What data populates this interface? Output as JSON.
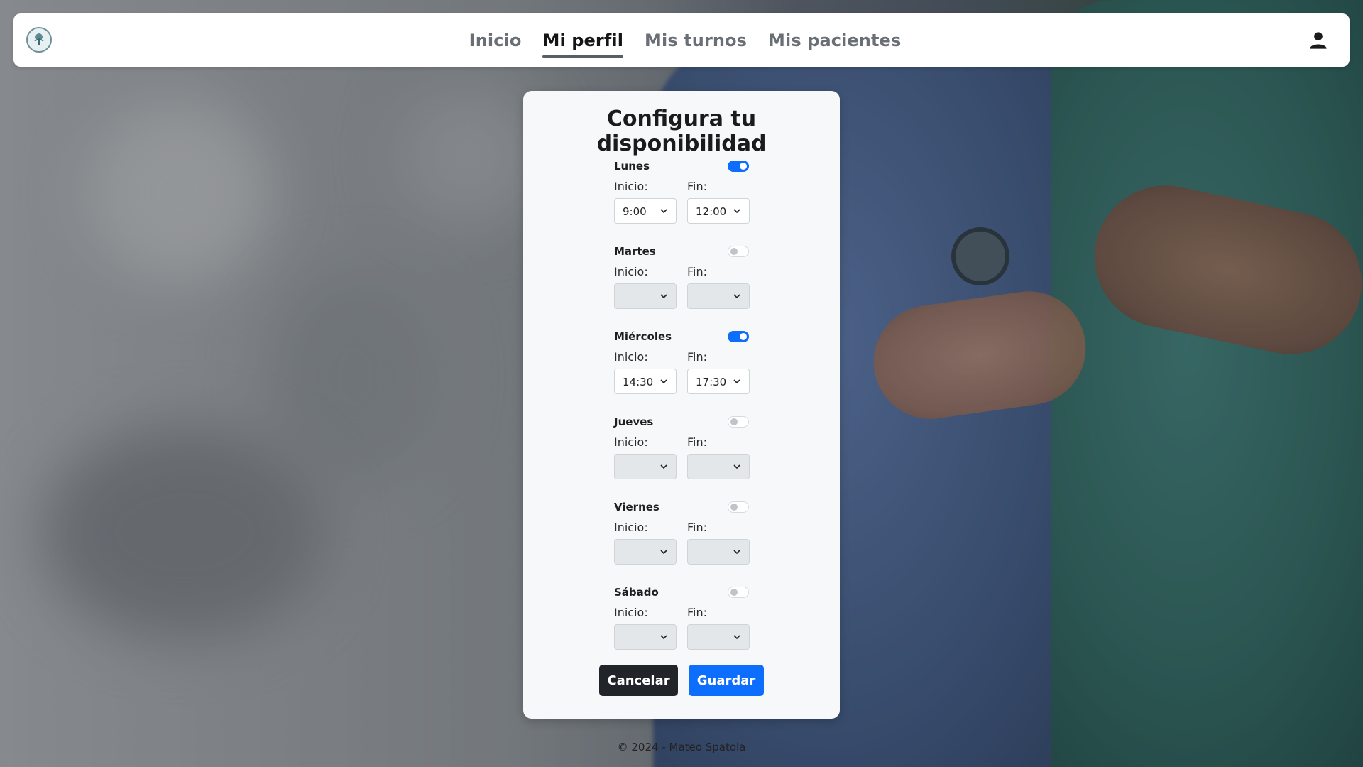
{
  "nav": {
    "links": [
      {
        "label": "Inicio"
      },
      {
        "label": "Mi perfil"
      },
      {
        "label": "Mis turnos"
      },
      {
        "label": "Mis pacientes"
      }
    ]
  },
  "card": {
    "title": "Configura tu disponibilidad",
    "start_label": "Inicio:",
    "end_label": "Fin:",
    "days": [
      {
        "name": "Lunes",
        "enabled": true,
        "start": "9:00",
        "end": "12:00"
      },
      {
        "name": "Martes",
        "enabled": false,
        "start": "",
        "end": ""
      },
      {
        "name": "Miércoles",
        "enabled": true,
        "start": "14:30",
        "end": "17:30"
      },
      {
        "name": "Jueves",
        "enabled": false,
        "start": "",
        "end": ""
      },
      {
        "name": "Viernes",
        "enabled": false,
        "start": "",
        "end": ""
      },
      {
        "name": "Sábado",
        "enabled": false,
        "start": "",
        "end": ""
      }
    ],
    "cancel_label": "Cancelar",
    "save_label": "Guardar"
  },
  "footer": {
    "text": "© 2024 - Mateo Spatola"
  },
  "colors": {
    "primary": "#0d6efd",
    "dark": "#212529"
  }
}
